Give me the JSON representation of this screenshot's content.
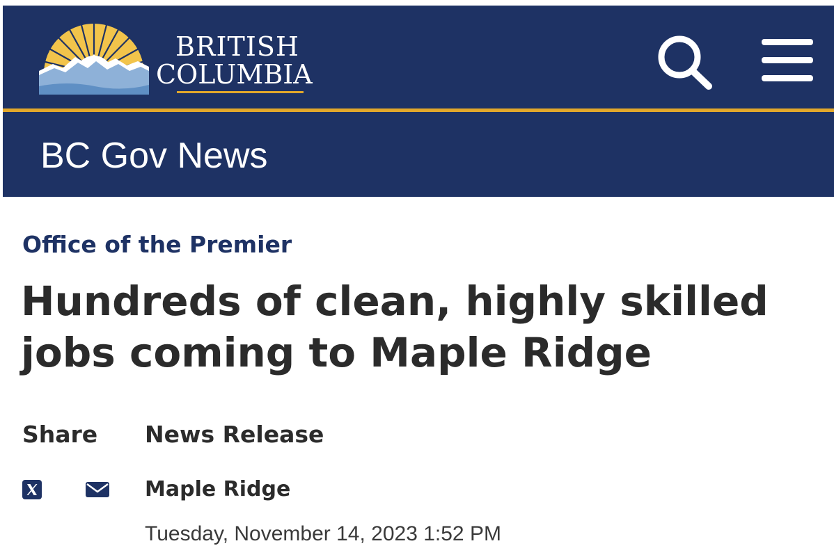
{
  "header": {
    "logo_line1": "BRITISH",
    "logo_line2": "COLUMBIA",
    "search_icon": "search-icon",
    "menu_icon": "hamburger-menu-icon",
    "colors": {
      "navy": "#1e3264",
      "gold": "#e3a82b",
      "sun_yellow": "#f2c44b",
      "mountain_blue": "#8eb1d8"
    }
  },
  "site": {
    "title": "BC Gov News"
  },
  "article": {
    "ministry": "Office of the Premier",
    "headline": "Hundreds of clean, highly skilled jobs coming to Maple Ridge",
    "release_type": "News Release",
    "location": "Maple Ridge",
    "date": "Tuesday, November 14, 2023 1:52 PM"
  },
  "share": {
    "label": "Share",
    "icons": [
      "x-twitter-icon",
      "mail-icon"
    ]
  }
}
